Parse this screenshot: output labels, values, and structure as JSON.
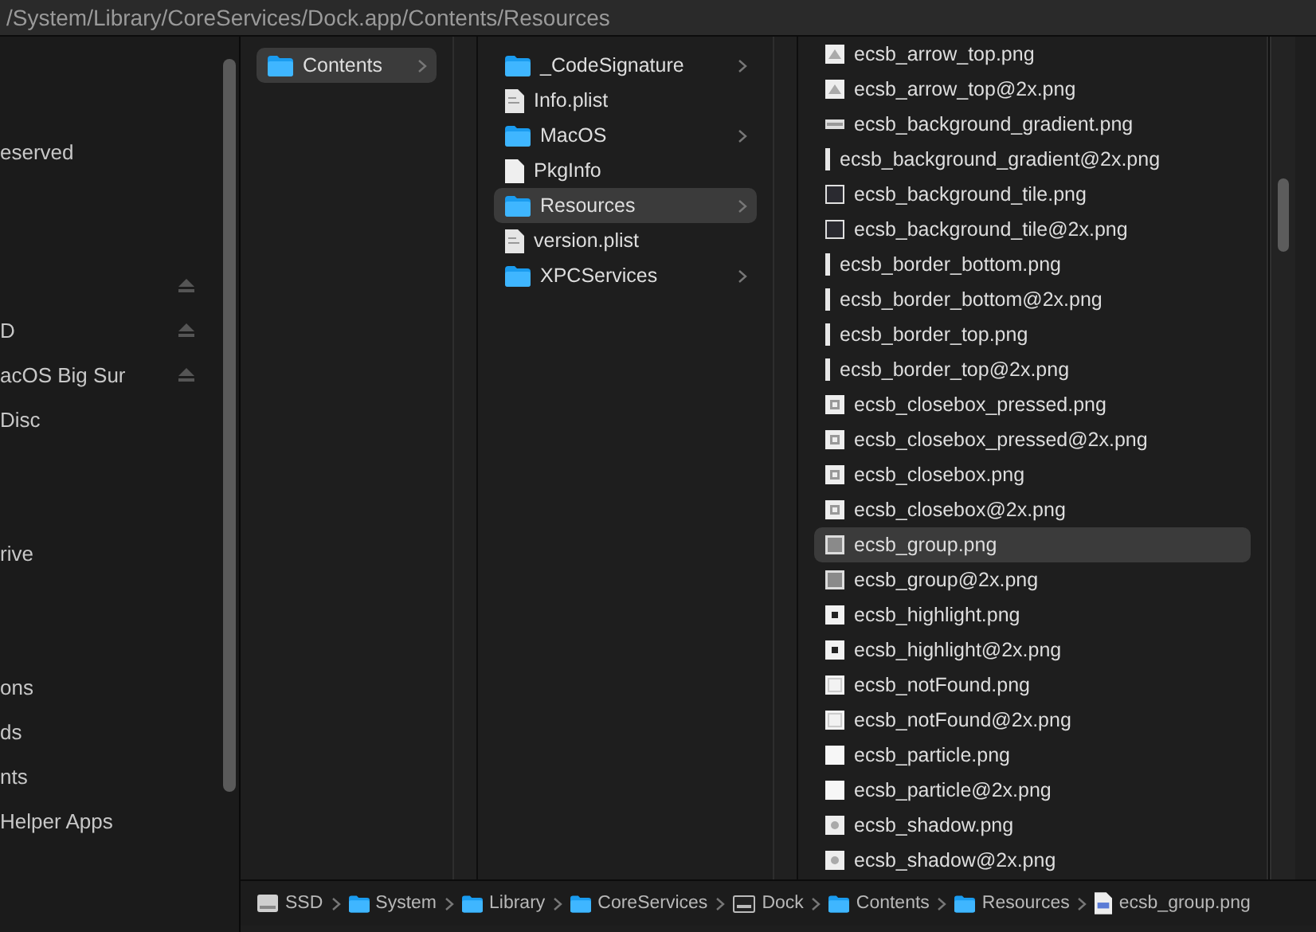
{
  "window": {
    "title": "/System/Library/CoreServices/Dock.app/Contents/Resources"
  },
  "sidebar": {
    "groups": [
      {
        "items": [
          {
            "label": "eserved",
            "ejectable": false
          }
        ]
      },
      {
        "items": [
          {
            "ejectable": true
          },
          {
            "label": "D",
            "ejectable": true
          },
          {
            "label": "acOS Big Sur",
            "ejectable": true
          },
          {
            "label": "Disc",
            "ejectable": false
          }
        ]
      },
      {
        "items": [
          {
            "label": "rive",
            "ejectable": false
          }
        ]
      },
      {
        "items": [
          {
            "label": "ons",
            "ejectable": false
          },
          {
            "label": "ds",
            "ejectable": false
          },
          {
            "label": "nts",
            "ejectable": false
          },
          {
            "label": "Helper Apps",
            "ejectable": false
          }
        ]
      }
    ]
  },
  "columns": [
    {
      "items": [
        {
          "name": "Contents",
          "kind": "folder",
          "selected": true
        }
      ]
    },
    {
      "items": [
        {
          "name": "_CodeSignature",
          "kind": "folder",
          "selected": false
        },
        {
          "name": "Info.plist",
          "kind": "document",
          "selected": false
        },
        {
          "name": "MacOS",
          "kind": "folder",
          "selected": false
        },
        {
          "name": "PkgInfo",
          "kind": "blank",
          "selected": false
        },
        {
          "name": "Resources",
          "kind": "folder",
          "selected": true
        },
        {
          "name": "version.plist",
          "kind": "document",
          "selected": false
        },
        {
          "name": "XPCServices",
          "kind": "folder",
          "selected": false
        }
      ]
    },
    {
      "items": [
        {
          "name": "ecsb_arrow_top.png",
          "kind": "arrow",
          "selected": false
        },
        {
          "name": "ecsb_arrow_top@2x.png",
          "kind": "arrow",
          "selected": false
        },
        {
          "name": "ecsb_background_gradient.png",
          "kind": "gradient",
          "selected": false
        },
        {
          "name": "ecsb_background_gradient@2x.png",
          "kind": "bar",
          "selected": false
        },
        {
          "name": "ecsb_background_tile.png",
          "kind": "tile",
          "selected": false
        },
        {
          "name": "ecsb_background_tile@2x.png",
          "kind": "tile",
          "selected": false
        },
        {
          "name": "ecsb_border_bottom.png",
          "kind": "bar",
          "selected": false
        },
        {
          "name": "ecsb_border_bottom@2x.png",
          "kind": "bar",
          "selected": false
        },
        {
          "name": "ecsb_border_top.png",
          "kind": "bar",
          "selected": false
        },
        {
          "name": "ecsb_border_top@2x.png",
          "kind": "bar",
          "selected": false
        },
        {
          "name": "ecsb_closebox_pressed.png",
          "kind": "closebox",
          "selected": false
        },
        {
          "name": "ecsb_closebox_pressed@2x.png",
          "kind": "closebox",
          "selected": false
        },
        {
          "name": "ecsb_closebox.png",
          "kind": "closebox",
          "selected": false
        },
        {
          "name": "ecsb_closebox@2x.png",
          "kind": "closebox",
          "selected": false
        },
        {
          "name": "ecsb_group.png",
          "kind": "group",
          "selected": true
        },
        {
          "name": "ecsb_group@2x.png",
          "kind": "group",
          "selected": false
        },
        {
          "name": "ecsb_highlight.png",
          "kind": "highlight",
          "selected": false
        },
        {
          "name": "ecsb_highlight@2x.png",
          "kind": "highlight",
          "selected": false
        },
        {
          "name": "ecsb_notFound.png",
          "kind": "notfound",
          "selected": false
        },
        {
          "name": "ecsb_notFound@2x.png",
          "kind": "notfound",
          "selected": false
        },
        {
          "name": "ecsb_particle.png",
          "kind": "blank",
          "selected": false
        },
        {
          "name": "ecsb_particle@2x.png",
          "kind": "blank",
          "selected": false
        },
        {
          "name": "ecsb_shadow.png",
          "kind": "shadow",
          "selected": false
        },
        {
          "name": "ecsb_shadow@2x.png",
          "kind": "shadow",
          "selected": false
        }
      ]
    }
  ],
  "path_bar": [
    {
      "name": "SSD",
      "kind": "disk"
    },
    {
      "name": "System",
      "kind": "folder"
    },
    {
      "name": "Library",
      "kind": "folder"
    },
    {
      "name": "CoreServices",
      "kind": "folder"
    },
    {
      "name": "Dock",
      "kind": "app"
    },
    {
      "name": "Contents",
      "kind": "folder"
    },
    {
      "name": "Resources",
      "kind": "folder"
    },
    {
      "name": "ecsb_group.png",
      "kind": "file"
    }
  ]
}
